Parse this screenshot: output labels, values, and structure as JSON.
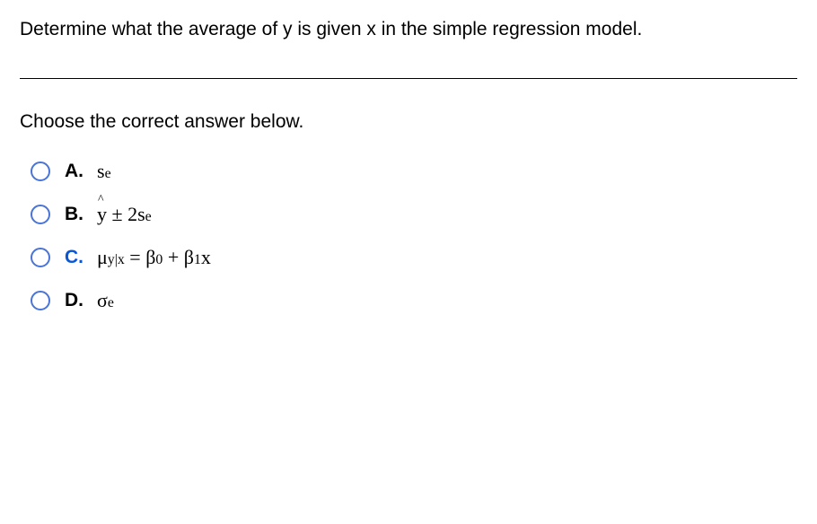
{
  "question": "Determine what the average of y is given x in the simple regression model.",
  "prompt": "Choose the correct answer below.",
  "options": {
    "a": {
      "letter": "A.",
      "formula_type": "s_e"
    },
    "b": {
      "letter": "B.",
      "formula_type": "yhat_pm_2se"
    },
    "c": {
      "letter": "C.",
      "formula_type": "mu_eq_beta"
    },
    "d": {
      "letter": "D.",
      "formula_type": "sigma_e"
    }
  }
}
